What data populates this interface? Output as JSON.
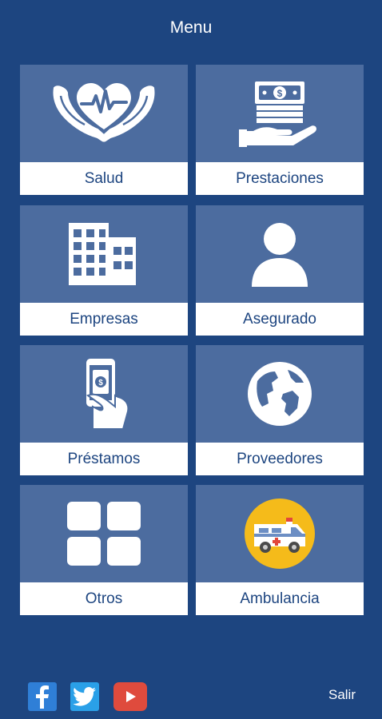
{
  "header": {
    "title": "Menu"
  },
  "tiles": [
    {
      "label": "Salud",
      "icon": "heart-hands-icon"
    },
    {
      "label": "Prestaciones",
      "icon": "money-hand-icon"
    },
    {
      "label": "Empresas",
      "icon": "building-icon"
    },
    {
      "label": "Asegurado",
      "icon": "person-icon"
    },
    {
      "label": "Préstamos",
      "icon": "hand-phone-money-icon"
    },
    {
      "label": "Proveedores",
      "icon": "globe-icon"
    },
    {
      "label": "Otros",
      "icon": "grid-icon"
    },
    {
      "label": "Ambulancia",
      "icon": "ambulance-icon"
    }
  ],
  "footer": {
    "social": [
      {
        "name": "facebook-icon",
        "color": "#2f7fd7"
      },
      {
        "name": "twitter-icon",
        "color": "#2aa0e8"
      },
      {
        "name": "youtube-icon",
        "color": "#df4b3d"
      }
    ],
    "logout_label": "Salir"
  },
  "colors": {
    "background": "#1d4580",
    "tile": "#4c6c9f",
    "label_bg": "#ffffff",
    "label_text": "#1d4580",
    "ambulance_circle": "#f5bb1a"
  }
}
